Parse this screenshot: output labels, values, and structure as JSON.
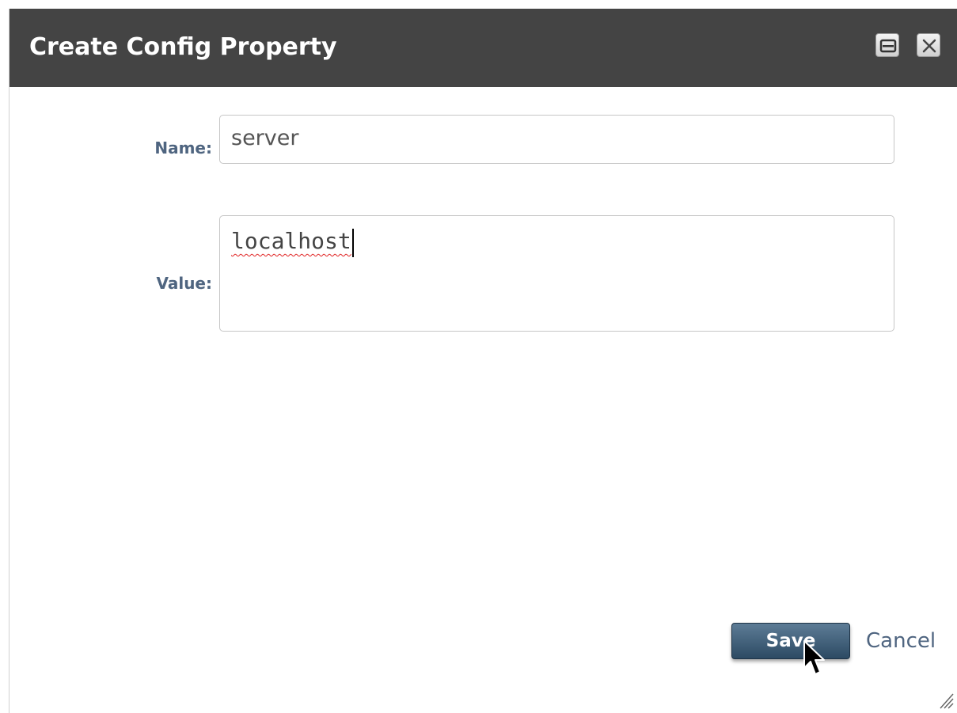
{
  "dialog": {
    "title": "Create Config Property",
    "window_buttons": {
      "minimize_icon": "minimize-icon",
      "close_icon": "close-icon"
    }
  },
  "form": {
    "name_label": "Name:",
    "name_value": "server",
    "value_label": "Value:",
    "value_value": "localhost",
    "value_spellcheck_flag": true
  },
  "actions": {
    "save_label": "Save",
    "cancel_label": "Cancel"
  },
  "colors": {
    "titlebar_bg": "#444444",
    "label_text": "#4f6580",
    "save_button_bg": "#3a5870",
    "spellcheck_underline": "#e02020"
  }
}
